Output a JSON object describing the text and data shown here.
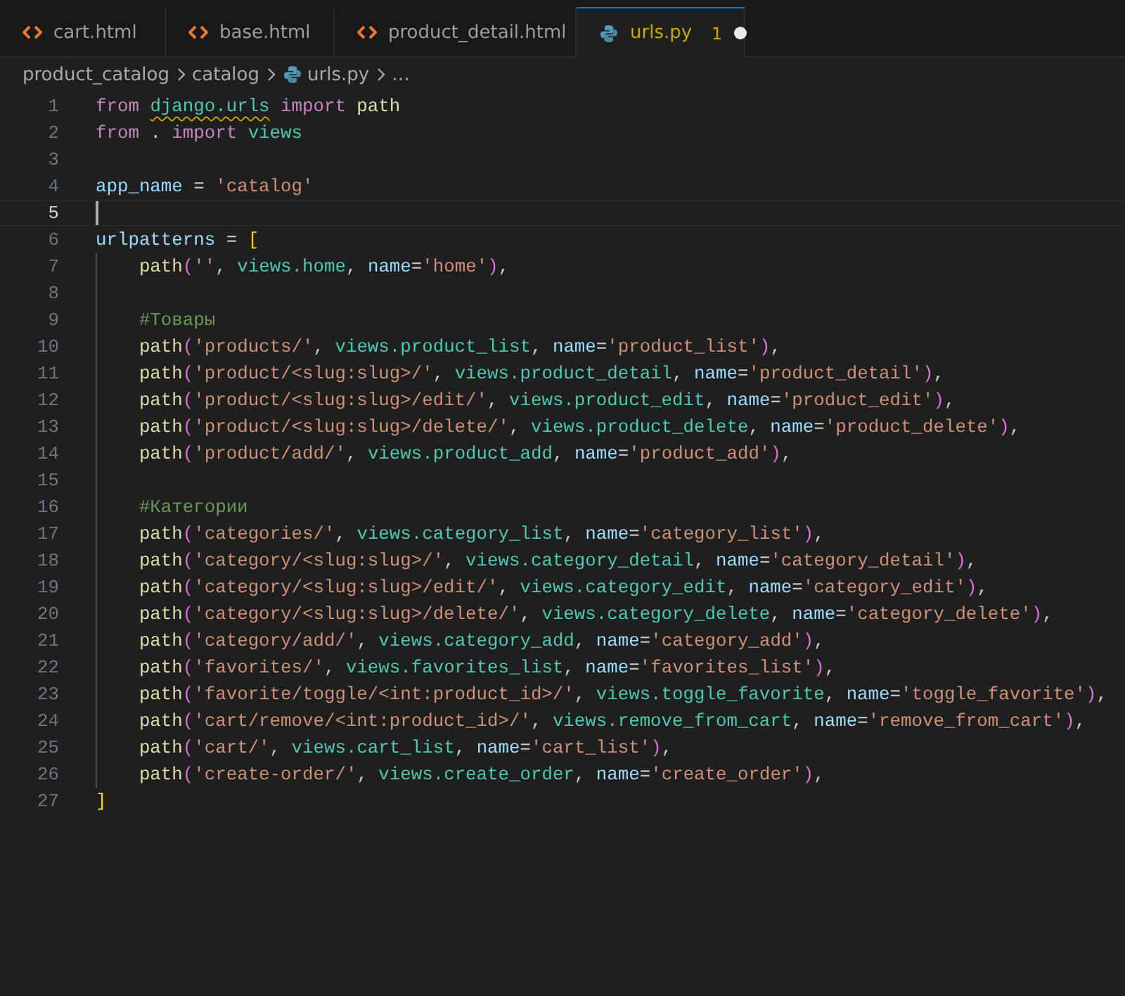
{
  "tabs": [
    {
      "label": "cart.html",
      "kind": "html",
      "selected": false
    },
    {
      "label": "base.html",
      "kind": "html",
      "selected": false
    },
    {
      "label": "product_detail.html",
      "kind": "html",
      "selected": false
    },
    {
      "label": "urls.py",
      "kind": "python",
      "selected": true,
      "problems": "1",
      "modified": true
    }
  ],
  "breadcrumb": [
    {
      "label": "product_catalog",
      "kind": "folder"
    },
    {
      "label": "catalog",
      "kind": "folder"
    },
    {
      "label": "urls.py",
      "kind": "python"
    },
    {
      "label": "…",
      "kind": "symbol"
    }
  ],
  "lines": [
    {
      "number": "1",
      "current": false,
      "indented": false,
      "tokens": [
        {
          "kind": "keyword",
          "text": "from "
        },
        {
          "kind": "module_warning",
          "text": "django.urls"
        },
        {
          "kind": "keyword",
          "text": " import "
        },
        {
          "kind": "function",
          "text": "path"
        }
      ]
    },
    {
      "number": "2",
      "current": false,
      "indented": false,
      "tokens": [
        {
          "kind": "keyword",
          "text": "from "
        },
        {
          "kind": "plain",
          "text": ". "
        },
        {
          "kind": "keyword",
          "text": "import "
        },
        {
          "kind": "module",
          "text": "views"
        }
      ]
    },
    {
      "number": "3",
      "current": false,
      "indented": false
    },
    {
      "number": "4",
      "current": false,
      "indented": false,
      "tokens": [
        {
          "kind": "variable",
          "text": "app_name"
        },
        {
          "kind": "plain",
          "text": " = "
        },
        {
          "kind": "string",
          "text": "'catalog'"
        }
      ]
    },
    {
      "number": "5",
      "current": true,
      "indented": false
    },
    {
      "number": "6",
      "current": false,
      "indented": false,
      "tokens": [
        {
          "kind": "variable",
          "text": "urlpatterns"
        },
        {
          "kind": "plain",
          "text": " = "
        },
        {
          "kind": "bracket",
          "text": "["
        }
      ]
    },
    {
      "number": "7",
      "current": false,
      "indented": true,
      "tokens": [
        {
          "kind": "function",
          "text": "path"
        },
        {
          "kind": "paren",
          "text": "("
        },
        {
          "kind": "string",
          "text": "''"
        },
        {
          "kind": "plain",
          "text": ", "
        },
        {
          "kind": "module",
          "text": "views.home"
        },
        {
          "kind": "plain",
          "text": ", "
        },
        {
          "kind": "parameter",
          "text": "name"
        },
        {
          "kind": "plain",
          "text": "="
        },
        {
          "kind": "string",
          "text": "'home'"
        },
        {
          "kind": "paren",
          "text": ")"
        },
        {
          "kind": "plain",
          "text": ","
        }
      ]
    },
    {
      "number": "8",
      "current": false,
      "indented": true
    },
    {
      "number": "9",
      "current": false,
      "indented": true,
      "tokens": [
        {
          "kind": "comment",
          "text": "#Товары"
        }
      ]
    },
    {
      "number": "10",
      "current": false,
      "indented": true,
      "tokens": [
        {
          "kind": "function",
          "text": "path"
        },
        {
          "kind": "paren",
          "text": "("
        },
        {
          "kind": "string",
          "text": "'products/'"
        },
        {
          "kind": "plain",
          "text": ", "
        },
        {
          "kind": "module",
          "text": "views.product_list"
        },
        {
          "kind": "plain",
          "text": ", "
        },
        {
          "kind": "parameter",
          "text": "name"
        },
        {
          "kind": "plain",
          "text": "="
        },
        {
          "kind": "string",
          "text": "'product_list'"
        },
        {
          "kind": "paren",
          "text": ")"
        },
        {
          "kind": "plain",
          "text": ","
        }
      ]
    },
    {
      "number": "11",
      "current": false,
      "indented": true,
      "tokens": [
        {
          "kind": "function",
          "text": "path"
        },
        {
          "kind": "paren",
          "text": "("
        },
        {
          "kind": "string",
          "text": "'product/<slug:slug>/'"
        },
        {
          "kind": "plain",
          "text": ", "
        },
        {
          "kind": "module",
          "text": "views.product_detail"
        },
        {
          "kind": "plain",
          "text": ", "
        },
        {
          "kind": "parameter",
          "text": "name"
        },
        {
          "kind": "plain",
          "text": "="
        },
        {
          "kind": "string",
          "text": "'product_detail'"
        },
        {
          "kind": "paren",
          "text": ")"
        },
        {
          "kind": "plain",
          "text": ","
        }
      ]
    },
    {
      "number": "12",
      "current": false,
      "indented": true,
      "tokens": [
        {
          "kind": "function",
          "text": "path"
        },
        {
          "kind": "paren",
          "text": "("
        },
        {
          "kind": "string",
          "text": "'product/<slug:slug>/edit/'"
        },
        {
          "kind": "plain",
          "text": ", "
        },
        {
          "kind": "module",
          "text": "views.product_edit"
        },
        {
          "kind": "plain",
          "text": ", "
        },
        {
          "kind": "parameter",
          "text": "name"
        },
        {
          "kind": "plain",
          "text": "="
        },
        {
          "kind": "string",
          "text": "'product_edit'"
        },
        {
          "kind": "paren",
          "text": ")"
        },
        {
          "kind": "plain",
          "text": ","
        }
      ]
    },
    {
      "number": "13",
      "current": false,
      "indented": true,
      "tokens": [
        {
          "kind": "function",
          "text": "path"
        },
        {
          "kind": "paren",
          "text": "("
        },
        {
          "kind": "string",
          "text": "'product/<slug:slug>/delete/'"
        },
        {
          "kind": "plain",
          "text": ", "
        },
        {
          "kind": "module",
          "text": "views.product_delete"
        },
        {
          "kind": "plain",
          "text": ", "
        },
        {
          "kind": "parameter",
          "text": "name"
        },
        {
          "kind": "plain",
          "text": "="
        },
        {
          "kind": "string",
          "text": "'product_delete'"
        },
        {
          "kind": "paren",
          "text": ")"
        },
        {
          "kind": "plain",
          "text": ","
        }
      ]
    },
    {
      "number": "14",
      "current": false,
      "indented": true,
      "tokens": [
        {
          "kind": "function",
          "text": "path"
        },
        {
          "kind": "paren",
          "text": "("
        },
        {
          "kind": "string",
          "text": "'product/add/'"
        },
        {
          "kind": "plain",
          "text": ", "
        },
        {
          "kind": "module",
          "text": "views.product_add"
        },
        {
          "kind": "plain",
          "text": ", "
        },
        {
          "kind": "parameter",
          "text": "name"
        },
        {
          "kind": "plain",
          "text": "="
        },
        {
          "kind": "string",
          "text": "'product_add'"
        },
        {
          "kind": "paren",
          "text": ")"
        },
        {
          "kind": "plain",
          "text": ","
        }
      ]
    },
    {
      "number": "15",
      "current": false,
      "indented": true
    },
    {
      "number": "16",
      "current": false,
      "indented": true,
      "tokens": [
        {
          "kind": "comment",
          "text": "#Категории"
        }
      ]
    },
    {
      "number": "17",
      "current": false,
      "indented": true,
      "tokens": [
        {
          "kind": "function",
          "text": "path"
        },
        {
          "kind": "paren",
          "text": "("
        },
        {
          "kind": "string",
          "text": "'categories/'"
        },
        {
          "kind": "plain",
          "text": ", "
        },
        {
          "kind": "module",
          "text": "views.category_list"
        },
        {
          "kind": "plain",
          "text": ", "
        },
        {
          "kind": "parameter",
          "text": "name"
        },
        {
          "kind": "plain",
          "text": "="
        },
        {
          "kind": "string",
          "text": "'category_list'"
        },
        {
          "kind": "paren",
          "text": ")"
        },
        {
          "kind": "plain",
          "text": ","
        }
      ]
    },
    {
      "number": "18",
      "current": false,
      "indented": true,
      "tokens": [
        {
          "kind": "function",
          "text": "path"
        },
        {
          "kind": "paren",
          "text": "("
        },
        {
          "kind": "string",
          "text": "'category/<slug:slug>/'"
        },
        {
          "kind": "plain",
          "text": ", "
        },
        {
          "kind": "module",
          "text": "views.category_detail"
        },
        {
          "kind": "plain",
          "text": ", "
        },
        {
          "kind": "parameter",
          "text": "name"
        },
        {
          "kind": "plain",
          "text": "="
        },
        {
          "kind": "string",
          "text": "'category_detail'"
        },
        {
          "kind": "paren",
          "text": ")"
        },
        {
          "kind": "plain",
          "text": ","
        }
      ]
    },
    {
      "number": "19",
      "current": false,
      "indented": true,
      "tokens": [
        {
          "kind": "function",
          "text": "path"
        },
        {
          "kind": "paren",
          "text": "("
        },
        {
          "kind": "string",
          "text": "'category/<slug:slug>/edit/'"
        },
        {
          "kind": "plain",
          "text": ", "
        },
        {
          "kind": "module",
          "text": "views.category_edit"
        },
        {
          "kind": "plain",
          "text": ", "
        },
        {
          "kind": "parameter",
          "text": "name"
        },
        {
          "kind": "plain",
          "text": "="
        },
        {
          "kind": "string",
          "text": "'category_edit'"
        },
        {
          "kind": "paren",
          "text": ")"
        },
        {
          "kind": "plain",
          "text": ","
        }
      ]
    },
    {
      "number": "20",
      "current": false,
      "indented": true,
      "tokens": [
        {
          "kind": "function",
          "text": "path"
        },
        {
          "kind": "paren",
          "text": "("
        },
        {
          "kind": "string",
          "text": "'category/<slug:slug>/delete/'"
        },
        {
          "kind": "plain",
          "text": ", "
        },
        {
          "kind": "module",
          "text": "views.category_delete"
        },
        {
          "kind": "plain",
          "text": ", "
        },
        {
          "kind": "parameter",
          "text": "name"
        },
        {
          "kind": "plain",
          "text": "="
        },
        {
          "kind": "string",
          "text": "'category_delete'"
        },
        {
          "kind": "paren",
          "text": ")"
        },
        {
          "kind": "plain",
          "text": ","
        }
      ]
    },
    {
      "number": "21",
      "current": false,
      "indented": true,
      "tokens": [
        {
          "kind": "function",
          "text": "path"
        },
        {
          "kind": "paren",
          "text": "("
        },
        {
          "kind": "string",
          "text": "'category/add/'"
        },
        {
          "kind": "plain",
          "text": ", "
        },
        {
          "kind": "module",
          "text": "views.category_add"
        },
        {
          "kind": "plain",
          "text": ", "
        },
        {
          "kind": "parameter",
          "text": "name"
        },
        {
          "kind": "plain",
          "text": "="
        },
        {
          "kind": "string",
          "text": "'category_add'"
        },
        {
          "kind": "paren",
          "text": ")"
        },
        {
          "kind": "plain",
          "text": ","
        }
      ]
    },
    {
      "number": "22",
      "current": false,
      "indented": true,
      "tokens": [
        {
          "kind": "function",
          "text": "path"
        },
        {
          "kind": "paren",
          "text": "("
        },
        {
          "kind": "string",
          "text": "'favorites/'"
        },
        {
          "kind": "plain",
          "text": ", "
        },
        {
          "kind": "module",
          "text": "views.favorites_list"
        },
        {
          "kind": "plain",
          "text": ", "
        },
        {
          "kind": "parameter",
          "text": "name"
        },
        {
          "kind": "plain",
          "text": "="
        },
        {
          "kind": "string",
          "text": "'favorites_list'"
        },
        {
          "kind": "paren",
          "text": ")"
        },
        {
          "kind": "plain",
          "text": ","
        }
      ]
    },
    {
      "number": "23",
      "current": false,
      "indented": true,
      "tokens": [
        {
          "kind": "function",
          "text": "path"
        },
        {
          "kind": "paren",
          "text": "("
        },
        {
          "kind": "string",
          "text": "'favorite/toggle/<int:product_id>/'"
        },
        {
          "kind": "plain",
          "text": ", "
        },
        {
          "kind": "module",
          "text": "views.toggle_favorite"
        },
        {
          "kind": "plain",
          "text": ", "
        },
        {
          "kind": "parameter",
          "text": "name"
        },
        {
          "kind": "plain",
          "text": "="
        },
        {
          "kind": "string",
          "text": "'toggle_favorite'"
        },
        {
          "kind": "paren",
          "text": ")"
        },
        {
          "kind": "plain",
          "text": ","
        }
      ]
    },
    {
      "number": "24",
      "current": false,
      "indented": true,
      "tokens": [
        {
          "kind": "function",
          "text": "path"
        },
        {
          "kind": "paren",
          "text": "("
        },
        {
          "kind": "string",
          "text": "'cart/remove/<int:product_id>/'"
        },
        {
          "kind": "plain",
          "text": ", "
        },
        {
          "kind": "module",
          "text": "views.remove_from_cart"
        },
        {
          "kind": "plain",
          "text": ", "
        },
        {
          "kind": "parameter",
          "text": "name"
        },
        {
          "kind": "plain",
          "text": "="
        },
        {
          "kind": "string",
          "text": "'remove_from_cart'"
        },
        {
          "kind": "paren",
          "text": ")"
        },
        {
          "kind": "plain",
          "text": ","
        }
      ]
    },
    {
      "number": "25",
      "current": false,
      "indented": true,
      "tokens": [
        {
          "kind": "function",
          "text": "path"
        },
        {
          "kind": "paren",
          "text": "("
        },
        {
          "kind": "string",
          "text": "'cart/'"
        },
        {
          "kind": "plain",
          "text": ", "
        },
        {
          "kind": "module",
          "text": "views.cart_list"
        },
        {
          "kind": "plain",
          "text": ", "
        },
        {
          "kind": "parameter",
          "text": "name"
        },
        {
          "kind": "plain",
          "text": "="
        },
        {
          "kind": "string",
          "text": "'cart_list'"
        },
        {
          "kind": "paren",
          "text": ")"
        },
        {
          "kind": "plain",
          "text": ","
        }
      ]
    },
    {
      "number": "26",
      "current": false,
      "indented": true,
      "tokens": [
        {
          "kind": "function",
          "text": "path"
        },
        {
          "kind": "paren",
          "text": "("
        },
        {
          "kind": "string",
          "text": "'create-order/'"
        },
        {
          "kind": "plain",
          "text": ", "
        },
        {
          "kind": "module",
          "text": "views.create_order"
        },
        {
          "kind": "plain",
          "text": ", "
        },
        {
          "kind": "parameter",
          "text": "name"
        },
        {
          "kind": "plain",
          "text": "="
        },
        {
          "kind": "string",
          "text": "'create_order'"
        },
        {
          "kind": "paren",
          "text": ")"
        },
        {
          "kind": "plain",
          "text": ","
        }
      ]
    },
    {
      "number": "27",
      "current": false,
      "indented": false,
      "tokens": [
        {
          "kind": "bracket",
          "text": "]"
        }
      ]
    }
  ]
}
